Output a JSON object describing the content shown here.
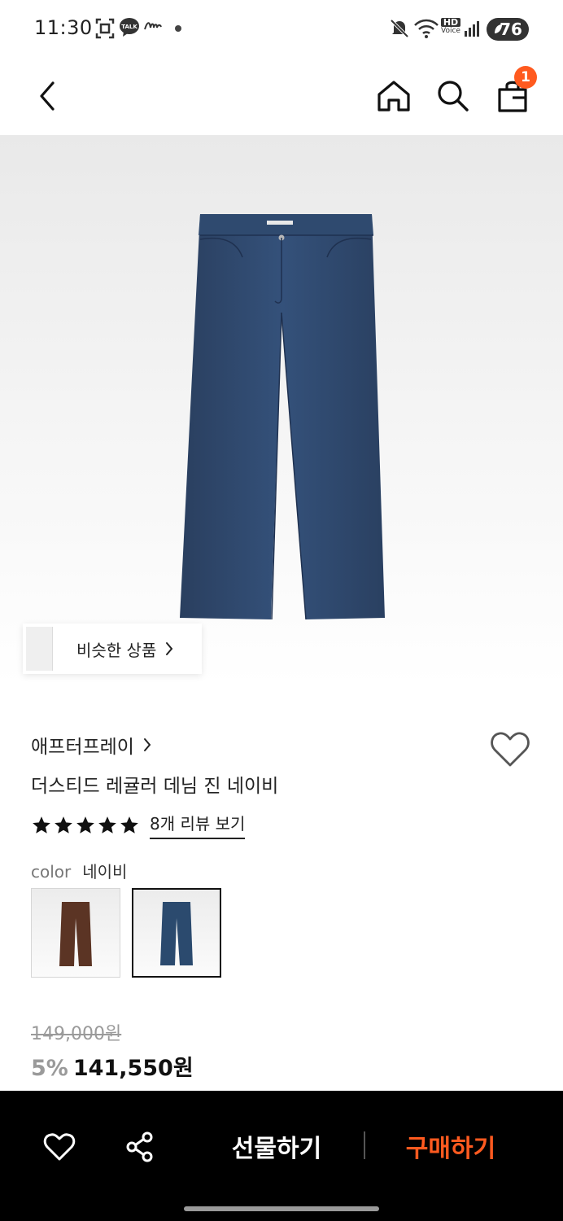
{
  "status_bar": {
    "time": "11:30",
    "icons": [
      "screenshot-icon",
      "kakaotalk-icon",
      "app-icon",
      "dot-icon",
      "mute-icon",
      "wifi-icon",
      "hd-voice-icon",
      "signal-icon"
    ],
    "kakao_label": "TALK",
    "hd_label": "HD",
    "voice_label": "Voice",
    "battery": "76"
  },
  "header": {
    "back_icon": "chevron-left-icon",
    "home_icon": "home-icon",
    "search_icon": "search-icon",
    "cart_icon": "shopping-bag-icon",
    "cart_count": "1"
  },
  "hero": {
    "image": "navy-denim-jeans",
    "similar_label": "비슷한 상품"
  },
  "product": {
    "brand": "애프터프레이",
    "name": "더스티드 레귤러 데님 진 네이비",
    "rating": 5,
    "review_link": "8개 리뷰 보기",
    "color_label": "color",
    "color_value": "네이비",
    "color_options": [
      {
        "name": "brown",
        "hex": "#5b3424",
        "selected": false
      },
      {
        "name": "navy",
        "hex": "#2b4a6e",
        "selected": true
      }
    ],
    "original_price": "149,000원",
    "discount": "5%",
    "final_price": "141,550원"
  },
  "bottom_bar": {
    "wish_icon": "heart-icon",
    "share_icon": "share-icon",
    "gift_label": "선물하기",
    "buy_label": "구매하기",
    "buy_color": "#ff5a1f"
  }
}
